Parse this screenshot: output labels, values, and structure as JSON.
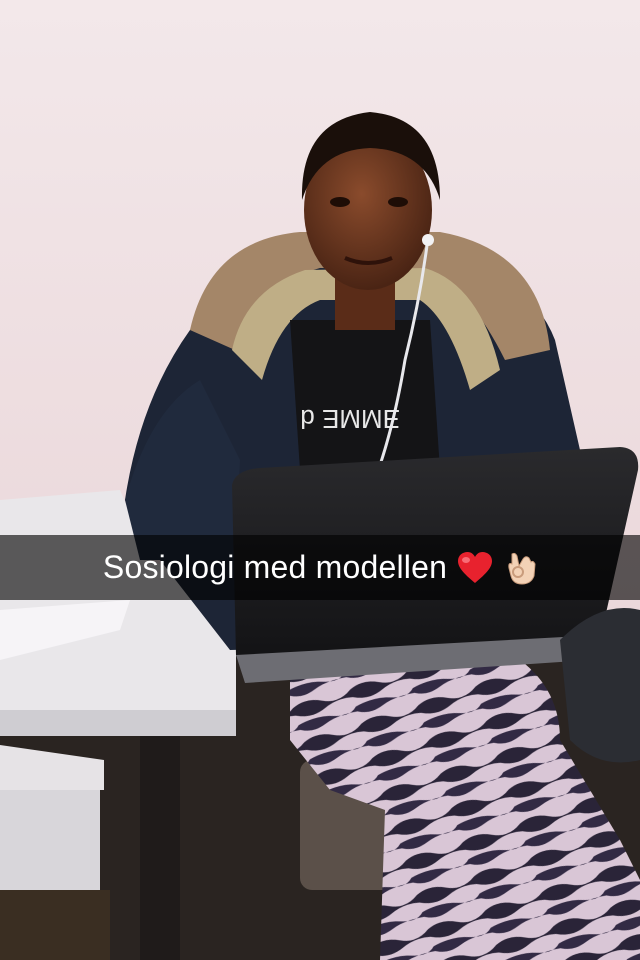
{
  "caption": {
    "text": "Sosiologi med modellen",
    "emojis": [
      "red-heart",
      "ok-hand"
    ]
  },
  "colors": {
    "wall": "#eedcde",
    "jacket": "#1d2536",
    "laptop": "#1b1b1d",
    "caption_bar": "#000000",
    "caption_text": "#ffffff"
  }
}
